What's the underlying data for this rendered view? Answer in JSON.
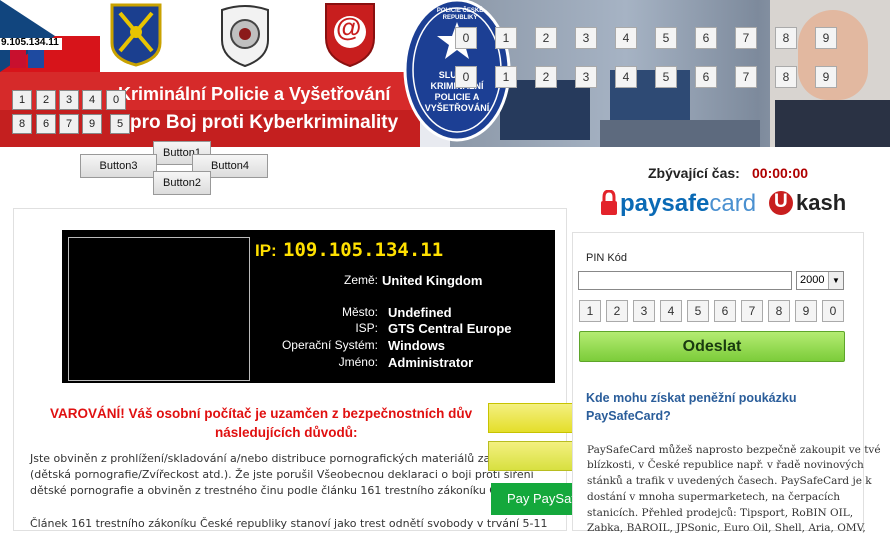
{
  "header": {
    "ip_small": "9.105.134.11",
    "banner_line1": "Kriminální Policie a Vyšetřování",
    "banner_line2": "pro Boj proti Kyberkriminality",
    "seal_text": "SLUŽBA KRIMINÁLNÍ POLICIE A VYŠETŘOVÁNÍ",
    "seal_ring": "POLICIE ČESKÉ REPUBLIKY",
    "at_symbol": "@",
    "left_keys_row1": [
      "1",
      "2",
      "3",
      "4",
      "0"
    ],
    "left_keys_row2": [
      "8",
      "6",
      "7",
      "9",
      "5"
    ],
    "top_keys_row1": [
      "0",
      "1",
      "2",
      "3",
      "4",
      "5",
      "6",
      "7",
      "8",
      "9"
    ],
    "top_keys_row2": [
      "0",
      "1",
      "2",
      "3",
      "4",
      "5",
      "6",
      "7",
      "8",
      "9"
    ]
  },
  "buttons": {
    "button1": "Button1",
    "button2": "Button2",
    "button3": "Button3",
    "button4": "Button4"
  },
  "timer": {
    "label": "Zbývající čas:",
    "value": "00:00:00"
  },
  "payment_logos": {
    "paysafe_lock": "🔒",
    "paysafe_text_bold": "paysafe",
    "paysafe_text_light": "card",
    "ukash_u": "U",
    "ukash_text": "kash"
  },
  "info": {
    "ip_label": "IP:",
    "ip_value": "109.105.134.11",
    "rows": [
      {
        "label": "Země:",
        "value": "United Kingdom"
      },
      {
        "label": "Město:",
        "value": "Undefined"
      },
      {
        "label": "ISP:",
        "value": "GTS Central Europe"
      },
      {
        "label": "Operační Systém:",
        "value": "Windows"
      },
      {
        "label": "Jméno:",
        "value": "Administrator"
      }
    ]
  },
  "warning": {
    "line1": "VAROVÁNÍ! Váš osobní počítač je uzamčen z bezpečnostních dův",
    "line2": "následujících důvodů:"
  },
  "body_paragraph": {
    "line1": "Jste obviněn z prohlížení/skladování a/nebo distribuce pornografických materiálů zaká",
    "line2": "(dětská pornografie/Zvířeckost atd.). Že jste porušil Všeobecnou deklaraci o boji proti šíření",
    "line3": "dětské pornografie a obviněn z trestného činu podle článku 161 trestního zákoníku Česk",
    "line4": "Článek 161 trestního zákoníku České republiky stanoví jako trest odnětí svobody v trvání 5-11"
  },
  "overlay": {
    "pay_button": "Pay PaySafe"
  },
  "pin_panel": {
    "label": "PIN Kód",
    "input_value": "",
    "select_value": "2000",
    "keys": [
      "1",
      "2",
      "3",
      "4",
      "5",
      "6",
      "7",
      "8",
      "9",
      "0"
    ],
    "submit": "Odeslat"
  },
  "help": {
    "title": "Kde mohu získat peněžní poukázku PaySafeCard?",
    "para_line1": "PaySafeCard můžeš naprosto bezpečně zakoupit ve tvé",
    "para_line2": "blízkosti, v České republice např. v řadě novinových",
    "para_line3": "stánků a trafik v uvedených časech. PaySafeCard je k",
    "para_line4": "dostání v mnoha supermarketech, na čerpacích",
    "para_line5": "stanicích. Přehled prodejců: Tipsport, RoBIN OIL,",
    "para_line6": "Zabka, BAROIL, JPSonic, Euro Oil, Shell, Aria, OMV,"
  },
  "colors": {
    "banner_red": "#d62a2a",
    "ip_yellow": "#ffe000",
    "warning_red": "#e01010",
    "timer_red": "#b00000",
    "paysafe_blue": "#0a6ab5",
    "paysafe_red": "#e3232b",
    "green_button": "#8cd64a",
    "help_blue": "#2a5d9a"
  }
}
